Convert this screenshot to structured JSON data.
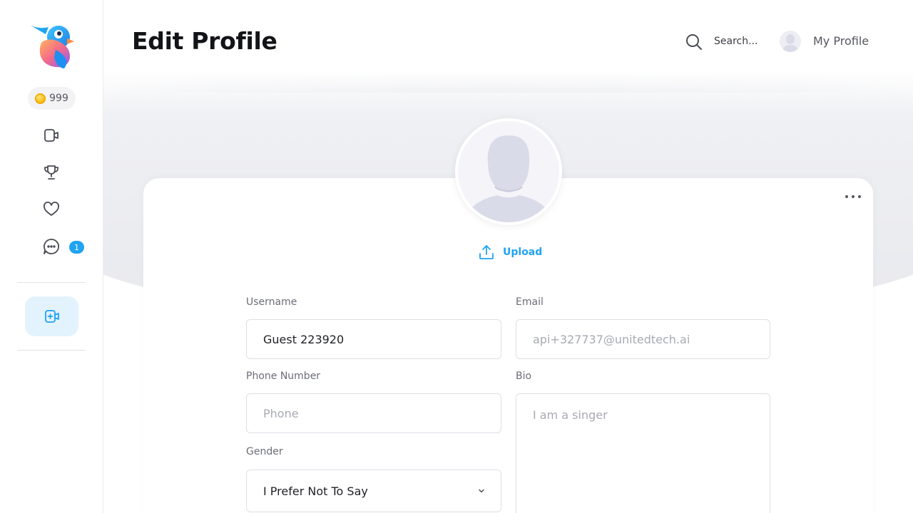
{
  "sidebar": {
    "coins": "999",
    "unread_count": "1",
    "items": [
      {
        "name": "video-icon"
      },
      {
        "name": "trophy-icon"
      },
      {
        "name": "heart-icon"
      },
      {
        "name": "chat-icon"
      }
    ]
  },
  "header": {
    "title": "Edit Profile",
    "search_placeholder": "Search...",
    "profile_label": "My Profile"
  },
  "profile": {
    "upload_label": "Upload"
  },
  "form": {
    "username_label": "Username",
    "username_value": "Guest 223920",
    "email_label": "Email",
    "email_value": "api+327737@unitedtech.ai",
    "phone_label": "Phone Number",
    "phone_placeholder": "Phone",
    "bio_label": "Bio",
    "bio_placeholder": "I am a singer",
    "gender_label": "Gender",
    "gender_value": "I Prefer Not To Say"
  },
  "colors": {
    "accent": "#1fa3f2",
    "accent_light": "#e3f3fd",
    "coin": "#f5b400"
  }
}
